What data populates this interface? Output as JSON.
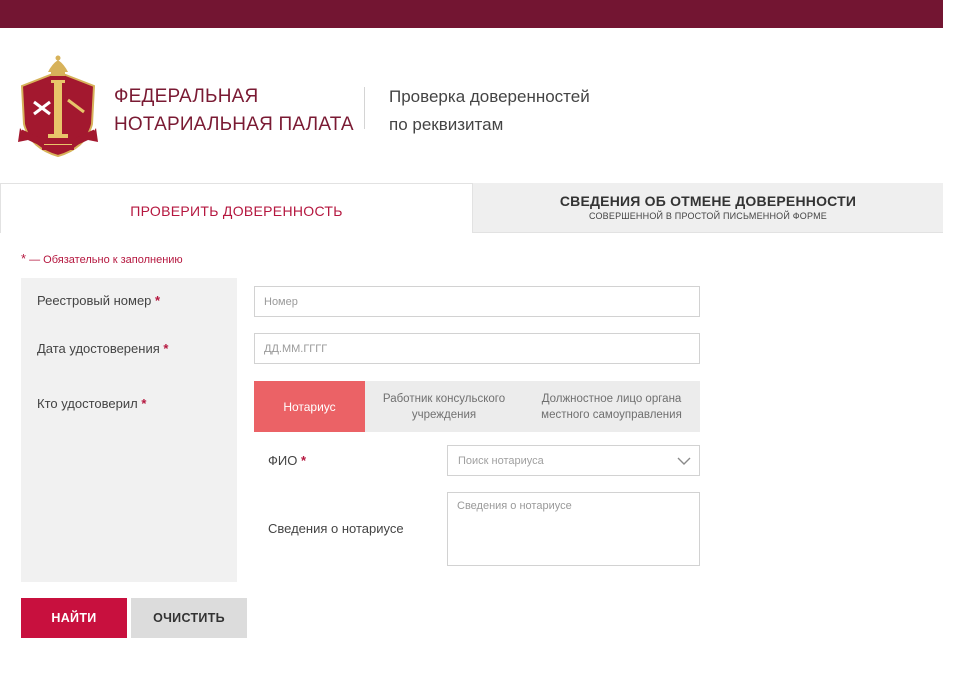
{
  "header": {
    "org_line1": "ФЕДЕРАЛЬНАЯ",
    "org_line2": "НОТАРИАЛЬНАЯ ПАЛАТА",
    "service_line1": "Проверка доверенностей",
    "service_line2": "по реквизитам",
    "logo_icon": "notary-emblem-icon"
  },
  "tabs": [
    {
      "label": "ПРОВЕРИТЬ ДОВЕРЕННОСТЬ",
      "active": true
    },
    {
      "label": "СВЕДЕНИЯ ОБ ОТМЕНЕ ДОВЕРЕННОСТИ",
      "sublabel": "СОВЕРШЕННОЙ В ПРОСТОЙ ПИСЬМЕННОЙ ФОРМЕ",
      "active": false
    }
  ],
  "form": {
    "required_star": "*",
    "required_note": "— Обязательно к заполнению",
    "registry_label": "Реестровый номер",
    "registry_placeholder": "Номер",
    "date_label": "Дата удостоверения",
    "date_placeholder": "ДД.ММ.ГГГГ",
    "certifier_label": "Кто удостоверил",
    "certifier_options": [
      "Нотариус",
      "Работник консульского учреждения",
      "Должностное лицо органа местного самоуправления"
    ],
    "certifier_selected": "Нотариус",
    "fio_label": "ФИО",
    "fio_placeholder": "Поиск нотариуса",
    "notary_info_label": "Сведения о нотариусе",
    "notary_info_placeholder": "Сведения о нотариусе"
  },
  "buttons": {
    "find": "НАЙТИ",
    "clear": "ОЧИСТИТЬ"
  },
  "colors": {
    "brand": "#731532",
    "accent": "#c8103e",
    "segment_active": "#eb6266",
    "required": "#b5173f"
  }
}
